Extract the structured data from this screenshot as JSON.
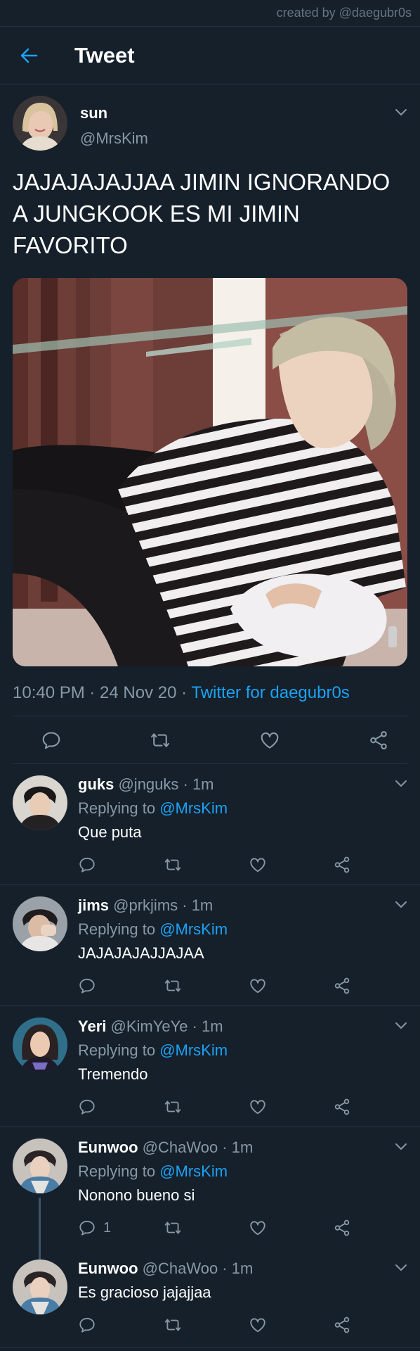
{
  "credit": "created by @daegubr0s",
  "header": {
    "title": "Tweet"
  },
  "tweet": {
    "name": "sun",
    "handle": "@MrsKim",
    "text": "JAJAJAJAJJAA JIMIN IGNORANDO A JUNGKOOK ES MI JIMIN FAVORITO",
    "time": "10:40 PM · 24 Nov 20 · ",
    "source": "Twitter for daegubr0s"
  },
  "replies": [
    {
      "name": "guks",
      "meta": " @jnguks · 1m",
      "replying_prefix": "Replying to ",
      "replying_to": "@MrsKim",
      "text": "Que puta",
      "reply_count": ""
    },
    {
      "name": "jims",
      "meta": " @prkjims · 1m",
      "replying_prefix": "Replying to ",
      "replying_to": "@MrsKim",
      "text": "JAJAJAJAJJAJAA",
      "reply_count": ""
    },
    {
      "name": "Yeri",
      "meta": " @KimYeYe · 1m",
      "replying_prefix": "Replying to ",
      "replying_to": "@MrsKim",
      "text": "Tremendo",
      "reply_count": ""
    },
    {
      "name": "Eunwoo",
      "meta": " @ChaWoo · 1m",
      "replying_prefix": "Replying to ",
      "replying_to": "@MrsKim",
      "text": "Nonono bueno si",
      "reply_count": "1"
    },
    {
      "name": "Eunwoo",
      "meta": " @ChaWoo · 1m",
      "text": "Es gracioso jajajjaa",
      "reply_count": ""
    }
  ],
  "colors": {
    "background": "#15202b",
    "accent": "#1da1f2",
    "muted": "#8899a6",
    "divider": "#253341"
  }
}
